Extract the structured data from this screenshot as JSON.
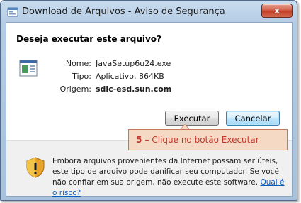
{
  "window": {
    "title": "Download de Arquivos - Aviso de Segurança",
    "close_label": "x"
  },
  "dialog": {
    "question": "Deseja executar este arquivo?",
    "fields": [
      {
        "label": "Nome:",
        "value": "JavaSetup6u24.exe"
      },
      {
        "label": "Tipo:",
        "value": "Aplicativo, 864KB"
      },
      {
        "label": "Origem:",
        "value": "sdlc-esd.sun.com"
      }
    ],
    "buttons": {
      "run": "Executar",
      "cancel": "Cancelar"
    },
    "warning_text": "Embora arquivos provenientes da Internet possam ser úteis, este tipo de arquivo pode danificar seu computador. Se você não confiar em sua origem, não execute este software.",
    "risk_link": "Qual é o risco?"
  },
  "callout": {
    "step": "5 –",
    "text": "Clique no botão Executar"
  },
  "colors": {
    "titlebar": "#b3cbe3",
    "callout_bg": "#f6d9c4",
    "callout_text": "#c0392b",
    "link": "#0b5cbf"
  }
}
